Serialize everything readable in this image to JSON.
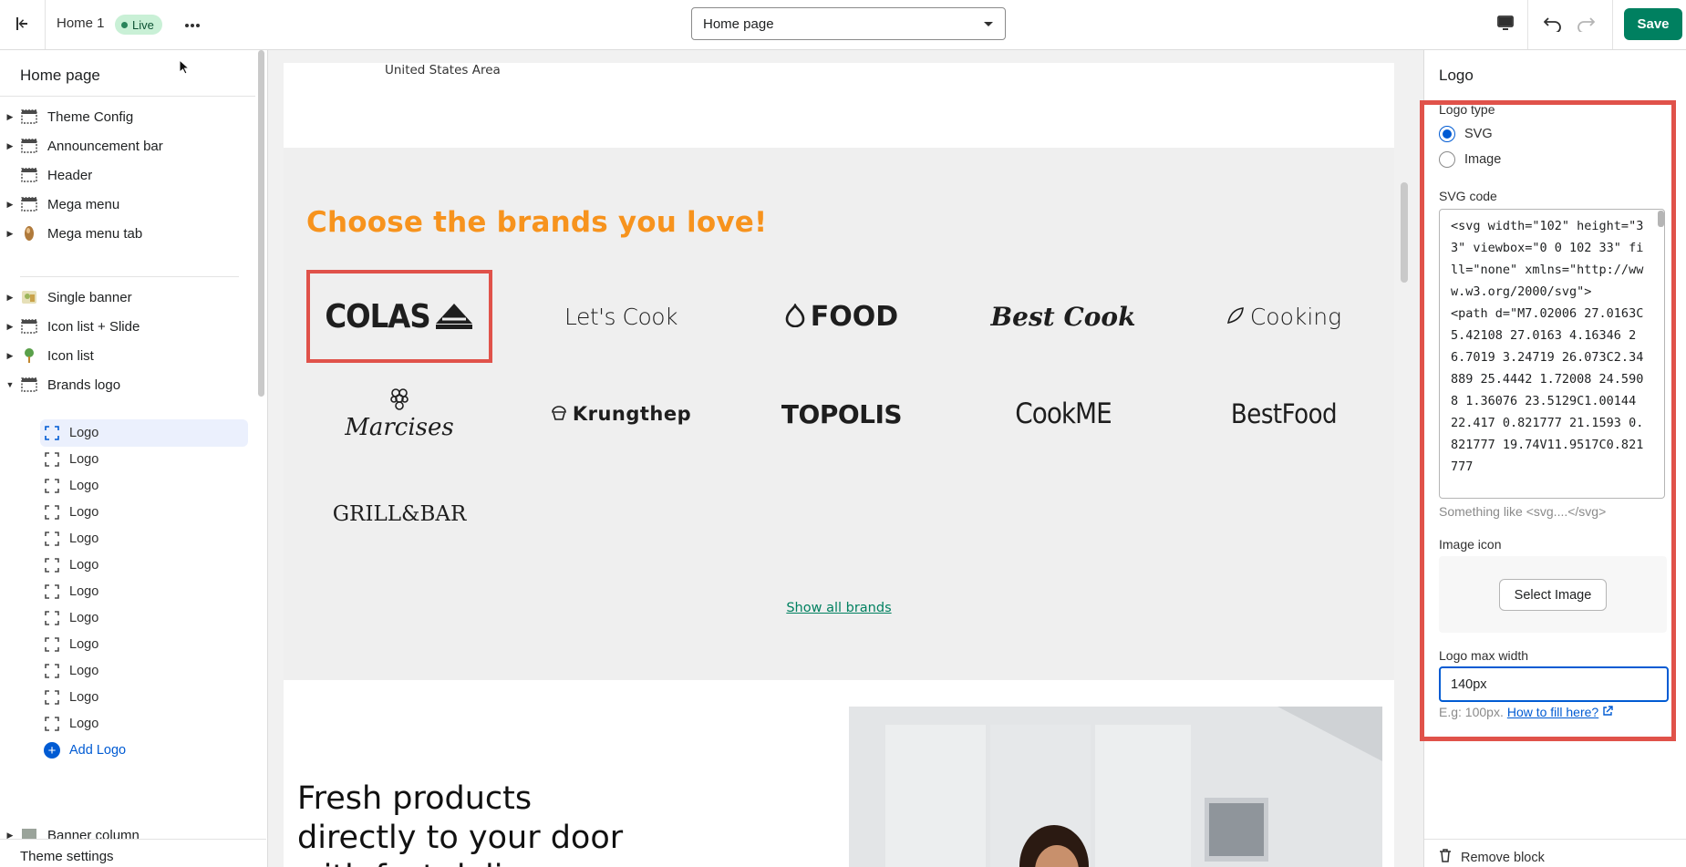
{
  "topbar": {
    "title": "Home 1",
    "badge": "Live",
    "page_select": "Home page",
    "save_label": "Save"
  },
  "sidebar": {
    "title": "Home page",
    "sections": [
      {
        "label": "Theme Config",
        "icon": "section-icon"
      },
      {
        "label": "Announcement bar",
        "icon": "section-icon"
      },
      {
        "label": "Header",
        "icon": "section-icon"
      },
      {
        "label": "Mega menu",
        "icon": "section-icon"
      },
      {
        "label": "Mega menu tab",
        "icon": "image-thumb-icon"
      },
      {
        "label": "Single banner",
        "icon": "image-thumb-icon"
      },
      {
        "label": "Icon list + Slide",
        "icon": "section-icon"
      },
      {
        "label": "Icon list",
        "icon": "pin-icon"
      },
      {
        "label": "Brands logo",
        "icon": "section-icon"
      }
    ],
    "logo_blocks": [
      "Logo",
      "Logo",
      "Logo",
      "Logo",
      "Logo",
      "Logo",
      "Logo",
      "Logo",
      "Logo",
      "Logo",
      "Logo",
      "Logo"
    ],
    "add_logo": "Add Logo",
    "next_section": "Banner column",
    "footer": "Theme settings"
  },
  "preview": {
    "location": "United States Area",
    "brands_title": "Choose the brands you love!",
    "brands": [
      "COLAS",
      "Let's Cook",
      "FOOD",
      "Best Cook",
      "Cooking",
      "Marcises",
      "Krungthep",
      "TOPOLIS",
      "CookME",
      "BestFood",
      "GRILL&BAR"
    ],
    "show_all": "Show all brands",
    "fresh_title": "Fresh products directly to your door with fast delivery"
  },
  "panel": {
    "title": "Logo",
    "logo_type_label": "Logo type",
    "options": [
      "SVG",
      "Image"
    ],
    "selected_option": "SVG",
    "svg_code_label": "SVG code",
    "svg_code": "<svg width=\"102\" height=\"33\" viewbox=\"0 0 102 33\" fill=\"none\" xmlns=\"http://www.w3.org/2000/svg\">\n<path d=\"M7.02006 27.0163C5.42108 27.0163 4.16346 26.7019 3.24719 26.073C2.34889 25.4442 1.72008 24.5908 1.36076 23.5129C1.00144 22.417 0.821777 21.1593 0.821777 19.74V11.9517C0.821777",
    "svg_help": "Something like <svg....</svg>",
    "image_icon_label": "Image icon",
    "select_image": "Select Image",
    "max_width_label": "Logo max width",
    "max_width_value": "140px",
    "eg_text": "E.g: 100px.",
    "how_to": "How to fill here?",
    "remove_block": "Remove block"
  },
  "colors": {
    "accent_green": "#008060",
    "brand_orange": "#f7931d",
    "highlight_red": "#e0524a",
    "link_blue": "#005bd3"
  }
}
